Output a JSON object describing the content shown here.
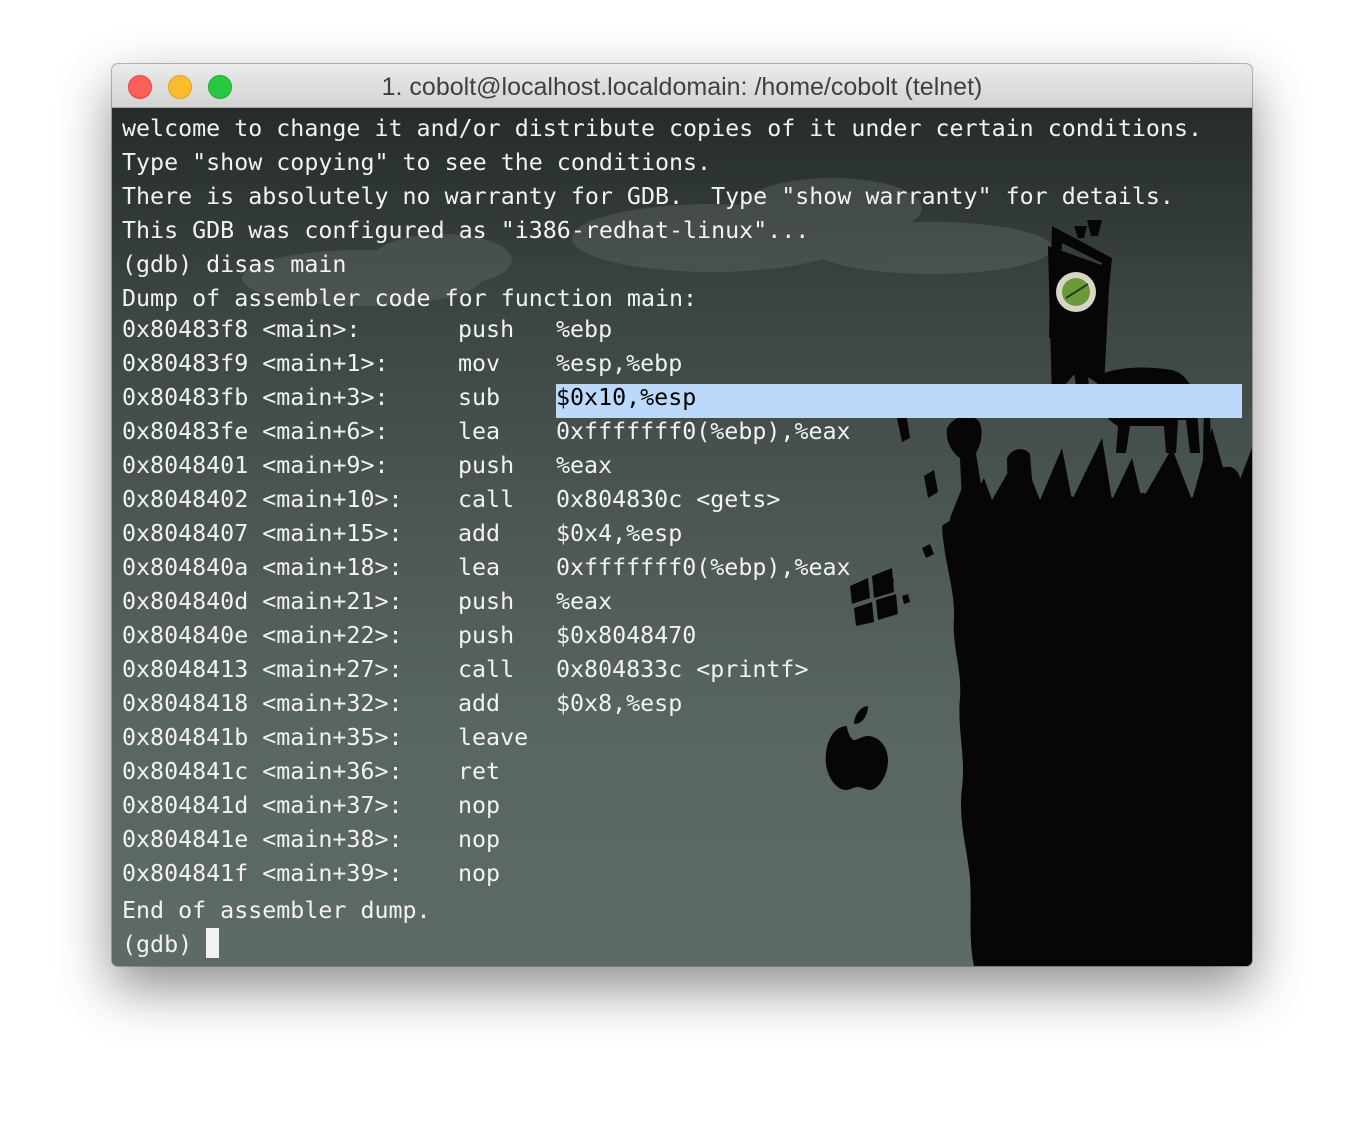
{
  "window": {
    "title": "1. cobolt@localhost.localdomain: /home/cobolt (telnet)",
    "buttons": [
      "close",
      "minimize",
      "zoom"
    ]
  },
  "colors": {
    "close": "#fc5f57",
    "minimize": "#fdbc2e",
    "zoom": "#29c840",
    "terminal_text": "#f2f2f2",
    "selection": "#bcd9fb"
  },
  "terminal": {
    "header_lines": [
      "welcome to change it and/or distribute copies of it under certain conditions.",
      "Type \"show copying\" to see the conditions.",
      "There is absolutely no warranty for GDB.  Type \"show warranty\" for details.",
      "This GDB was configured as \"i386-redhat-linux\"...",
      "(gdb) disas main",
      "Dump of assembler code for function main:"
    ],
    "asm": [
      {
        "addr": "0x80483f8 <main>:",
        "mnem": "push",
        "ops": "%ebp"
      },
      {
        "addr": "0x80483f9 <main+1>:",
        "mnem": "mov",
        "ops": "%esp,%ebp"
      },
      {
        "addr": "0x80483fb <main+3>:",
        "mnem": "sub",
        "ops": "$0x10,%esp"
      },
      {
        "addr": "0x80483fe <main+6>:",
        "mnem": "lea",
        "ops": "0xfffffff0(%ebp),%eax"
      },
      {
        "addr": "0x8048401 <main+9>:",
        "mnem": "push",
        "ops": "%eax"
      },
      {
        "addr": "0x8048402 <main+10>:",
        "mnem": "call",
        "ops": "0x804830c <gets>"
      },
      {
        "addr": "0x8048407 <main+15>:",
        "mnem": "add",
        "ops": "$0x4,%esp"
      },
      {
        "addr": "0x804840a <main+18>:",
        "mnem": "lea",
        "ops": "0xfffffff0(%ebp),%eax"
      },
      {
        "addr": "0x804840d <main+21>:",
        "mnem": "push",
        "ops": "%eax"
      },
      {
        "addr": "0x804840e <main+22>:",
        "mnem": "push",
        "ops": "$0x8048470"
      },
      {
        "addr": "0x8048413 <main+27>:",
        "mnem": "call",
        "ops": "0x804833c <printf>"
      },
      {
        "addr": "0x8048418 <main+32>:",
        "mnem": "add",
        "ops": "$0x8,%esp"
      },
      {
        "addr": "0x804841b <main+35>:",
        "mnem": "leave",
        "ops": ""
      },
      {
        "addr": "0x804841c <main+36>:",
        "mnem": "ret",
        "ops": ""
      },
      {
        "addr": "0x804841d <main+37>:",
        "mnem": "nop",
        "ops": ""
      },
      {
        "addr": "0x804841e <main+38>:",
        "mnem": "nop",
        "ops": ""
      },
      {
        "addr": "0x804841f <main+39>:",
        "mnem": "nop",
        "ops": ""
      }
    ],
    "selected_row": 2,
    "footer": "End of assembler dump.",
    "prompt": "(gdb) "
  },
  "background_icons": [
    "cliff-silhouette-icon",
    "flag-banner-icon",
    "windows-logo-icon",
    "apple-logo-icon",
    "cloud-icon"
  ]
}
